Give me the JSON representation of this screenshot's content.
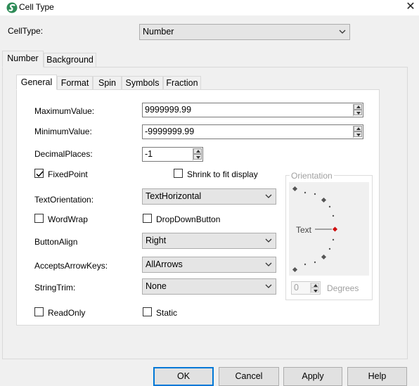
{
  "window": {
    "title": "Cell Type",
    "close_glyph": "✕"
  },
  "celltype": {
    "label": "CellType:",
    "value": "Number"
  },
  "outer_tabs": [
    {
      "label": "Number",
      "active": true
    },
    {
      "label": "Background",
      "active": false
    }
  ],
  "inner_tabs": [
    {
      "label": "General",
      "active": true
    },
    {
      "label": "Format",
      "active": false
    },
    {
      "label": "Spin",
      "active": false
    },
    {
      "label": "Symbols",
      "active": false
    },
    {
      "label": "Fraction",
      "active": false
    }
  ],
  "general": {
    "max_label": "MaximumValue:",
    "max_value": "9999999.99",
    "min_label": "MinimumValue:",
    "min_value": "-9999999.99",
    "decimal_label": "DecimalPlaces:",
    "decimal_value": "-1",
    "fixedpoint_label": "FixedPoint",
    "fixedpoint_checked": true,
    "shrink_label": "Shrink to fit display",
    "shrink_checked": false,
    "textorientation_label": "TextOrientation:",
    "textorientation_value": "TextHorizontal",
    "wordwrap_label": "WordWrap",
    "wordwrap_checked": false,
    "dropdownbutton_label": "DropDownButton",
    "dropdownbutton_checked": false,
    "buttonalign_label": "ButtonAlign",
    "buttonalign_value": "Right",
    "acceptsarrowkeys_label": "AcceptsArrowKeys:",
    "acceptsarrowkeys_value": "AllArrows",
    "stringtrim_label": "StringTrim:",
    "stringtrim_value": "None",
    "readonly_label": "ReadOnly",
    "readonly_checked": false,
    "static_label": "Static",
    "static_checked": false
  },
  "orientation": {
    "group_label": "Orientation",
    "text_label": "Text",
    "degrees_value": "0",
    "degrees_label": "Degrees"
  },
  "buttons": {
    "ok": "OK",
    "cancel": "Cancel",
    "apply": "Apply",
    "help": "Help"
  },
  "colors": {
    "accent": "#0078d7",
    "orientation_marker": "#d01010",
    "dot": "#555555"
  }
}
